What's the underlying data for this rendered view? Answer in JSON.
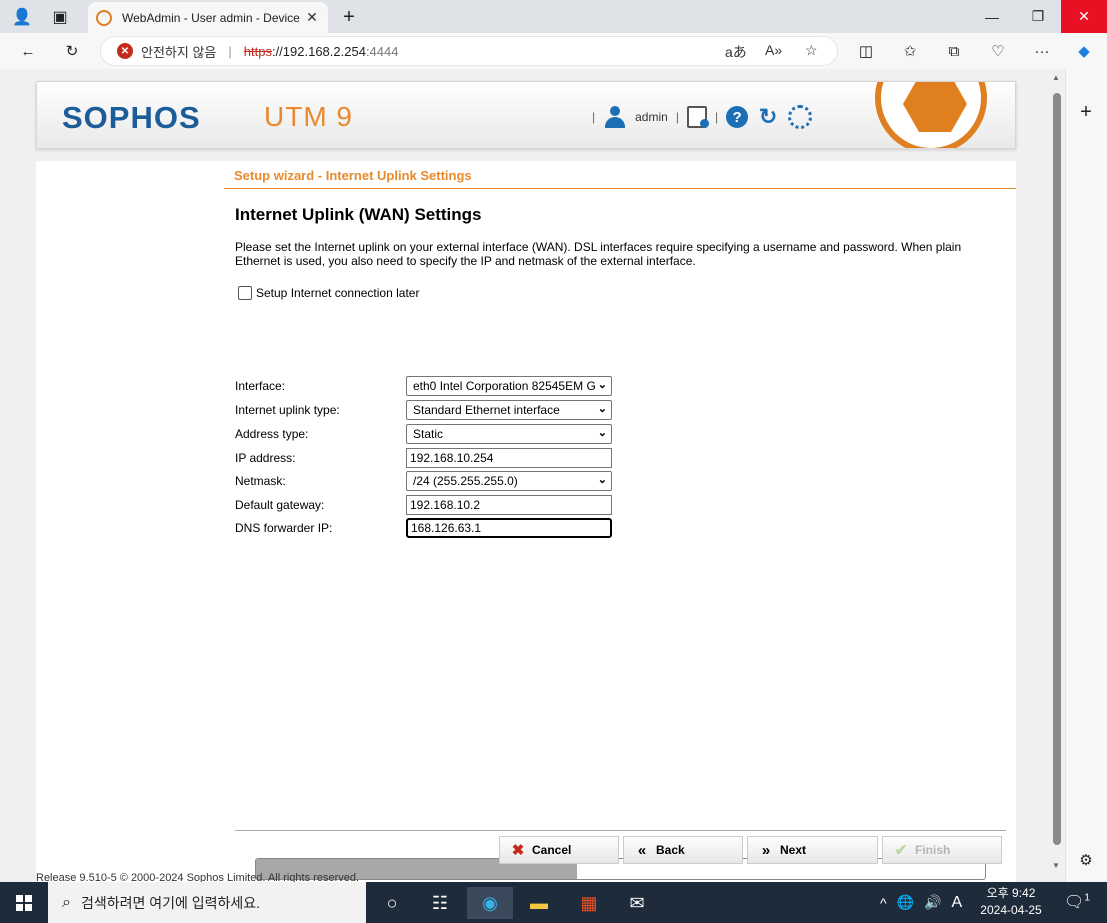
{
  "browser": {
    "tab_title": "WebAdmin - User admin - Device",
    "security_text": "안전하지 않음",
    "url_proto": "https",
    "url_host": "://192.168.2.254",
    "url_port": ":4444"
  },
  "header": {
    "logo": "SOPHOS",
    "product": "UTM 9",
    "user": "admin"
  },
  "wizard": {
    "breadcrumb": "Setup wizard - Internet Uplink Settings",
    "title": "Internet Uplink (WAN) Settings",
    "intro": "Please set the Internet uplink on your external interface (WAN). DSL interfaces require specifying a username and password. When plain Ethernet is used, you also need to specify the IP and netmask of the external interface.",
    "later_label": "Setup Internet connection later",
    "fields": {
      "interface": {
        "label": "Interface:",
        "value": "eth0 Intel Corporation 82545EM G"
      },
      "uplink_type": {
        "label": "Internet uplink type:",
        "value": "Standard Ethernet interface"
      },
      "address_type": {
        "label": "Address type:",
        "value": "Static"
      },
      "ip": {
        "label": "IP address:",
        "value": "192.168.10.254"
      },
      "netmask": {
        "label": "Netmask:",
        "value": "/24 (255.255.255.0)"
      },
      "gateway": {
        "label": "Default gateway:",
        "value": "192.168.10.2"
      },
      "dns": {
        "label": "DNS forwarder IP:",
        "value": "168.126.63.1"
      }
    },
    "progress": 0.44,
    "buttons": {
      "cancel": "Cancel",
      "back": "Back",
      "next": "Next",
      "finish": "Finish"
    },
    "release": "Release 9.510-5  © 2000-2024 Sophos Limited. All rights reserved."
  },
  "taskbar": {
    "search_placeholder": "검색하려면 여기에 입력하세요.",
    "time": "오후 9:42",
    "date": "2024-04-25",
    "ime": "A",
    "notif_count": "1"
  }
}
